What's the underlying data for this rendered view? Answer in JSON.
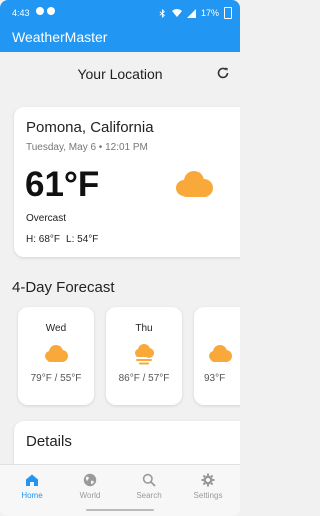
{
  "status_bar": {
    "time": "4:43",
    "battery": "17%"
  },
  "app": {
    "title": "WeatherMaster"
  },
  "location_header": {
    "title": "Your Location"
  },
  "current": {
    "city": "Pomona, California",
    "date": "Tuesday, May 6 • 12:01 PM",
    "temperature": "61°F",
    "condition": "Overcast",
    "high": "H: 68°F",
    "low": "L: 54°F",
    "icon": "cloud-icon"
  },
  "forecast": {
    "title": "4-Day Forecast",
    "days": [
      {
        "day": "Wed",
        "range": "79°F / 55°F",
        "icon": "cloud-icon"
      },
      {
        "day": "Thu",
        "range": "86°F / 57°F",
        "icon": "cloud-fog-icon"
      },
      {
        "day": "",
        "range": "93°F",
        "icon": "cloud-icon"
      }
    ]
  },
  "details": {
    "title": "Details"
  },
  "nav": {
    "items": [
      {
        "label": "Home",
        "icon": "home-icon",
        "active": true
      },
      {
        "label": "World",
        "icon": "globe-icon",
        "active": false
      },
      {
        "label": "Search",
        "icon": "search-icon",
        "active": false
      },
      {
        "label": "Settings",
        "icon": "gear-icon",
        "active": false
      }
    ]
  },
  "colors": {
    "accent": "#2196f3",
    "sun_cloud": "#f9a83a",
    "background": "#f1f1f1"
  }
}
